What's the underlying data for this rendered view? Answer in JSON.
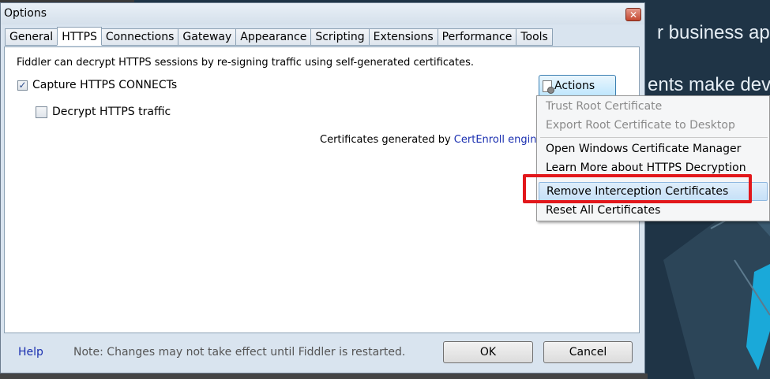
{
  "background": {
    "text_line1": "r business app",
    "text_line2": "ents make dev"
  },
  "window": {
    "title": "Options",
    "close_glyph": "✕"
  },
  "tabs": [
    {
      "label": "General"
    },
    {
      "label": "HTTPS",
      "active": true
    },
    {
      "label": "Connections"
    },
    {
      "label": "Gateway"
    },
    {
      "label": "Appearance"
    },
    {
      "label": "Scripting"
    },
    {
      "label": "Extensions"
    },
    {
      "label": "Performance"
    },
    {
      "label": "Tools"
    }
  ],
  "https": {
    "description": "Fiddler can decrypt HTTPS sessions by re-signing traffic using self-generated certificates.",
    "capture_label": "Capture HTTPS CONNECTs",
    "capture_checked": true,
    "decrypt_label": "Decrypt HTTPS traffic",
    "decrypt_checked": false,
    "cert_prefix": "Certificates generated by",
    "cert_link": "CertEnroll engine",
    "actions_label": "Actions"
  },
  "menu": {
    "items": [
      {
        "label": "Trust Root Certificate",
        "disabled": true
      },
      {
        "label": "Export Root Certificate to Desktop",
        "disabled": true
      },
      {
        "label": "Open Windows Certificate Manager"
      },
      {
        "label": "Learn More about HTTPS Decryption"
      },
      {
        "label": "Remove Interception Certificates",
        "hover": true
      },
      {
        "label": "Reset All Certificates"
      }
    ]
  },
  "footer": {
    "help_label": "Help",
    "note": "Note: Changes may not take effect until Fiddler is restarted.",
    "ok_label": "OK",
    "cancel_label": "Cancel"
  },
  "colors": {
    "highlight": "#e2171b",
    "link": "#1a2fb0"
  },
  "icons": {
    "close": "close-icon",
    "actions": "certificate-doc-icon",
    "checkbox": "checkmark-icon"
  }
}
